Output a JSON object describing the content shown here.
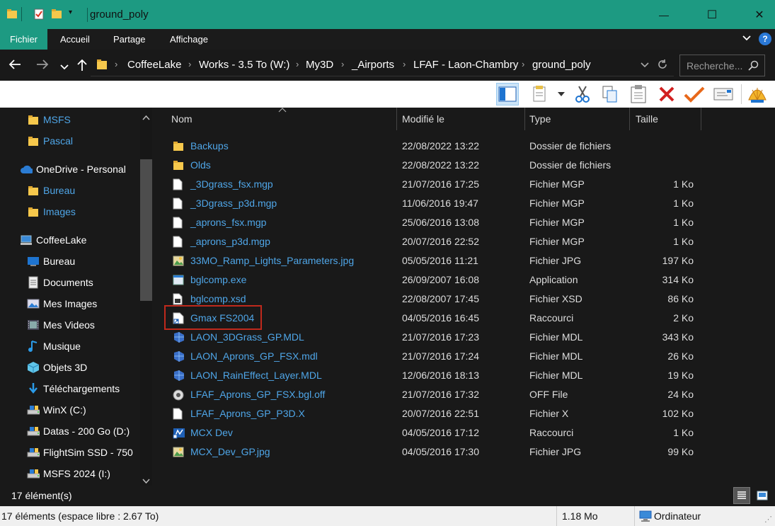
{
  "window": {
    "title": "ground_poly",
    "minimize": "—",
    "maximize": "☐",
    "close": "✕"
  },
  "ribbon": {
    "tabs": [
      "Fichier",
      "Accueil",
      "Partage",
      "Affichage"
    ]
  },
  "address": {
    "crumbs": [
      "CoffeeLake",
      "Works - 3.5 To (W:)",
      "My3D",
      "_Airports",
      "LFAF - Laon-Chambry",
      "ground_poly"
    ],
    "search_placeholder": "Recherche..."
  },
  "nav": {
    "items": [
      {
        "label": "MSFS",
        "icon": "folder-icon",
        "indent": 1
      },
      {
        "label": "Pascal",
        "icon": "folder-icon",
        "indent": 1
      },
      {
        "label": "OneDrive - Personal",
        "icon": "cloud-icon",
        "indent": 0
      },
      {
        "label": "Bureau",
        "icon": "folder-icon",
        "indent": 1
      },
      {
        "label": "Images",
        "icon": "folder-icon",
        "indent": 1
      },
      {
        "label": "CoffeeLake",
        "icon": "computer-icon",
        "indent": 0
      },
      {
        "label": "Bureau",
        "icon": "desktop-icon",
        "indent": 1
      },
      {
        "label": "Documents",
        "icon": "documents-icon",
        "indent": 1
      },
      {
        "label": "Mes Images",
        "icon": "pictures-icon",
        "indent": 1
      },
      {
        "label": "Mes Videos",
        "icon": "videos-icon",
        "indent": 1
      },
      {
        "label": "Musique",
        "icon": "music-icon",
        "indent": 1
      },
      {
        "label": "Objets 3D",
        "icon": "cube-icon",
        "indent": 1
      },
      {
        "label": "Téléchargements",
        "icon": "download-icon",
        "indent": 1
      },
      {
        "label": "WinX (C:)",
        "icon": "drive-icon",
        "indent": 1
      },
      {
        "label": "Datas - 200 Go (D:)",
        "icon": "drive-icon",
        "indent": 1
      },
      {
        "label": "FlightSim SSD - 750",
        "icon": "drive-icon",
        "indent": 1
      },
      {
        "label": "MSFS 2024 (I:)",
        "icon": "drive-icon",
        "indent": 1
      }
    ]
  },
  "columns": {
    "name": "Nom",
    "modified": "Modifié le",
    "type": "Type",
    "size": "Taille"
  },
  "files": [
    {
      "name": "Backups",
      "modified": "22/08/2022 13:22",
      "type": "Dossier de fichiers",
      "size": "",
      "icon": "folder-icon"
    },
    {
      "name": "Olds",
      "modified": "22/08/2022 13:22",
      "type": "Dossier de fichiers",
      "size": "",
      "icon": "folder-icon"
    },
    {
      "name": "_3Dgrass_fsx.mgp",
      "modified": "21/07/2016 17:25",
      "type": "Fichier MGP",
      "size": "1 Ko",
      "icon": "file-icon"
    },
    {
      "name": "_3Dgrass_p3d.mgp",
      "modified": "11/06/2016 19:47",
      "type": "Fichier MGP",
      "size": "1 Ko",
      "icon": "file-icon"
    },
    {
      "name": "_aprons_fsx.mgp",
      "modified": "25/06/2016 13:08",
      "type": "Fichier MGP",
      "size": "1 Ko",
      "icon": "file-icon"
    },
    {
      "name": "_aprons_p3d.mgp",
      "modified": "20/07/2016 22:52",
      "type": "Fichier MGP",
      "size": "1 Ko",
      "icon": "file-icon"
    },
    {
      "name": "33MO_Ramp_Lights_Parameters.jpg",
      "modified": "05/05/2016 11:21",
      "type": "Fichier JPG",
      "size": "197 Ko",
      "icon": "image-icon"
    },
    {
      "name": "bglcomp.exe",
      "modified": "26/09/2007 16:08",
      "type": "Application",
      "size": "314 Ko",
      "icon": "exe-icon"
    },
    {
      "name": "bglcomp.xsd",
      "modified": "22/08/2007 17:45",
      "type": "Fichier XSD",
      "size": "86 Ko",
      "icon": "xsd-icon"
    },
    {
      "name": "Gmax FS2004",
      "modified": "04/05/2016 16:45",
      "type": "Raccourci",
      "size": "2 Ko",
      "icon": "shortcut-icon"
    },
    {
      "name": "LAON_3DGrass_GP.MDL",
      "modified": "21/07/2016 17:23",
      "type": "Fichier MDL",
      "size": "343 Ko",
      "icon": "mdl-icon"
    },
    {
      "name": "LAON_Aprons_GP_FSX.mdl",
      "modified": "21/07/2016 17:24",
      "type": "Fichier MDL",
      "size": "26 Ko",
      "icon": "mdl-icon"
    },
    {
      "name": "LAON_RainEffect_Layer.MDL",
      "modified": "12/06/2016 18:13",
      "type": "Fichier MDL",
      "size": "19 Ko",
      "icon": "mdl-icon"
    },
    {
      "name": "LFAF_Aprons_GP_FSX.bgl.off",
      "modified": "21/07/2016 17:32",
      "type": "OFF File",
      "size": "24 Ko",
      "icon": "off-icon"
    },
    {
      "name": "LFAF_Aprons_GP_P3D.X",
      "modified": "20/07/2016 22:51",
      "type": "Fichier X",
      "size": "102 Ko",
      "icon": "file-icon"
    },
    {
      "name": "MCX Dev",
      "modified": "04/05/2016 17:12",
      "type": "Raccourci",
      "size": "1 Ko",
      "icon": "mcx-icon"
    },
    {
      "name": "MCX_Dev_GP.jpg",
      "modified": "04/05/2016 17:30",
      "type": "Fichier JPG",
      "size": "99 Ko",
      "icon": "image-icon"
    }
  ],
  "status": {
    "count": "17 élément(s)"
  },
  "bottom": {
    "info": "17 éléments (espace libre : 2.67 To)",
    "size": "1.18 Mo",
    "location": "Ordinateur"
  },
  "colors": {
    "accent": "#1d9a82",
    "link": "#4fa6e8",
    "highlight": "#c0291c"
  }
}
